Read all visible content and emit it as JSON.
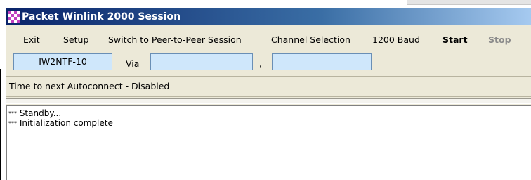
{
  "window": {
    "title": "Packet Winlink 2000 Session"
  },
  "menu": [
    {
      "label": "Exit",
      "style": "normal"
    },
    {
      "label": "Setup",
      "style": "normal"
    },
    {
      "label": "Switch to Peer-to-Peer Session",
      "style": "normal"
    },
    {
      "label": "Channel Selection",
      "style": "normal"
    },
    {
      "label": "1200 Baud",
      "style": "normal"
    },
    {
      "label": "Start",
      "style": "bold"
    },
    {
      "label": "Stop",
      "style": "disabled"
    }
  ],
  "connection": {
    "callsign": "IW2NTF-10",
    "via_label": "Via",
    "via1": "",
    "via2": "",
    "separator": ","
  },
  "status": {
    "autoconnect": "Time to next Autoconnect - Disabled"
  },
  "log": [
    {
      "prefix": "***",
      "text": " Standby..."
    },
    {
      "prefix": "***",
      "text": " Initialization complete"
    }
  ],
  "colors": {
    "title_bar_start": "#0a246a",
    "title_bar_end": "#a6caf0",
    "input_background": "#cfe7fb",
    "window_background": "#ece9d8"
  }
}
